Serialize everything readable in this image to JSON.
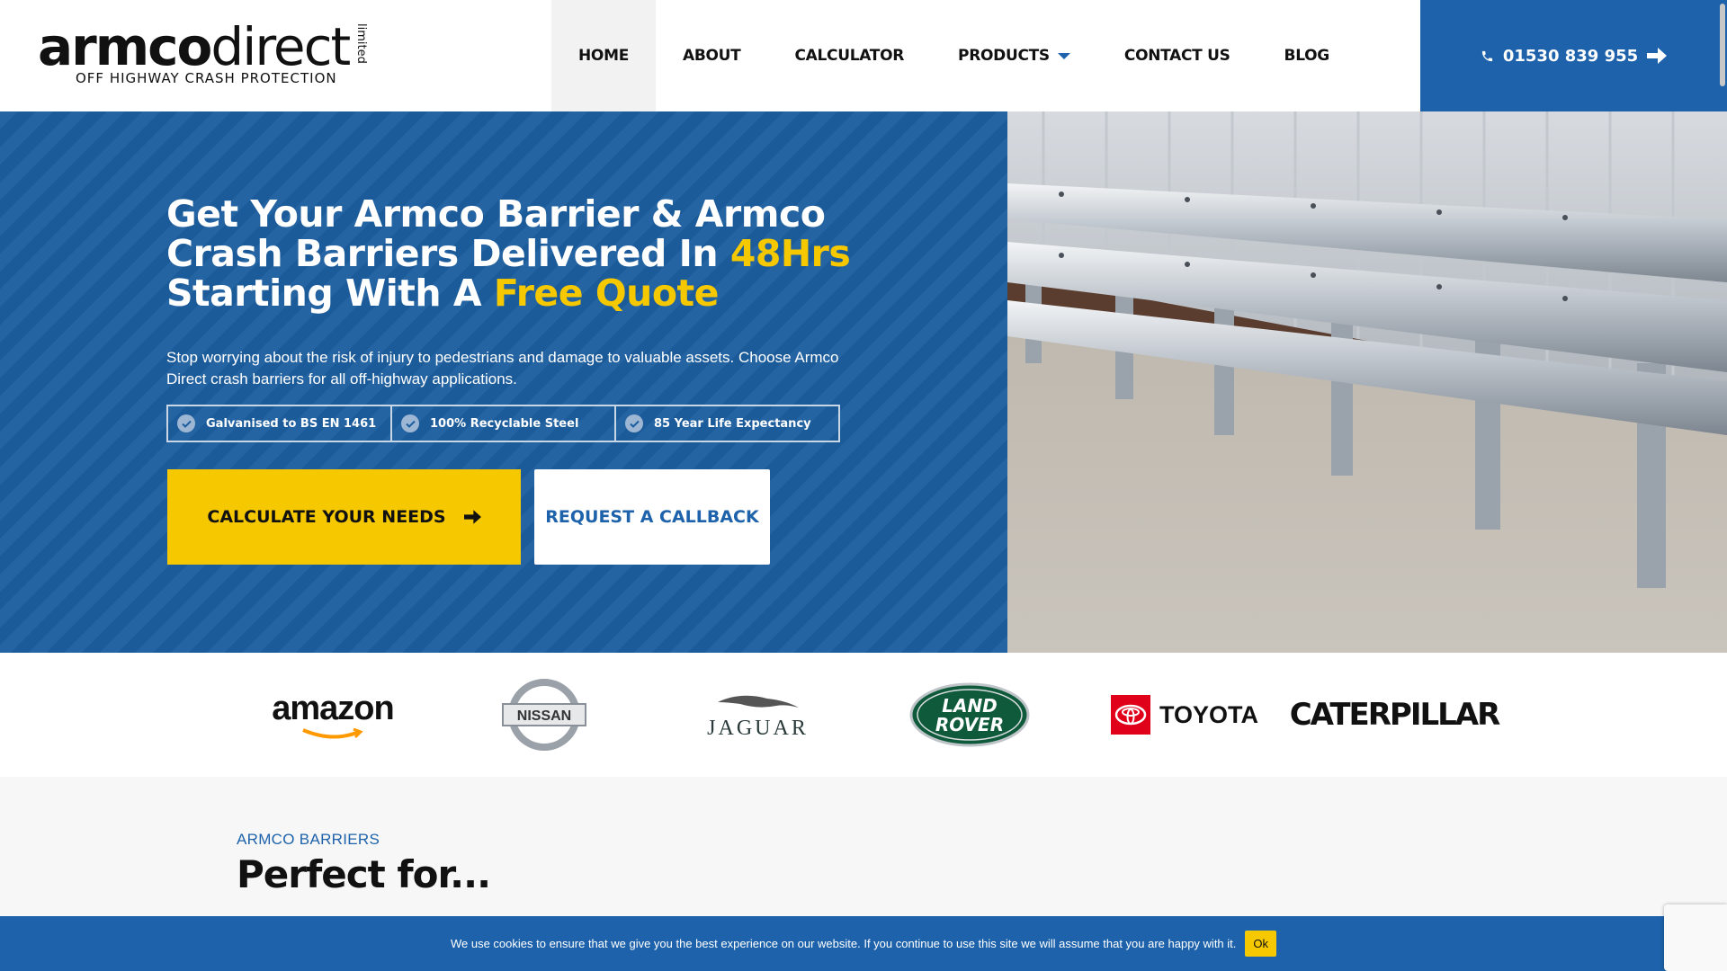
{
  "header": {
    "logo": {
      "bold": "armco",
      "light": "direct",
      "limited": "limited",
      "tagline": "OFF HIGHWAY CRASH PROTECTION"
    },
    "nav": [
      {
        "label": "HOME",
        "active": true
      },
      {
        "label": "ABOUT"
      },
      {
        "label": "CALCULATOR"
      },
      {
        "label": "PRODUCTS",
        "has_dropdown": true
      },
      {
        "label": "CONTACT US"
      },
      {
        "label": "BLOG"
      }
    ],
    "phone": "01530 839 955"
  },
  "hero": {
    "title_1": "Get Your Armco Barrier & Armco Crash Barriers Delivered In ",
    "title_hl1": "48Hrs",
    "title_2": " Starting With A ",
    "title_hl2": "Free Quote",
    "description": "Stop worrying about the risk of injury to pedestrians and damage to valuable assets. Choose Armco Direct crash barriers for all off-highway applications.",
    "features": [
      "Galvanised to BS EN 1461",
      "100% Recyclable Steel",
      "85 Year Life Expectancy"
    ],
    "cta_primary": "CALCULATE YOUR NEEDS",
    "cta_secondary": "REQUEST A CALLBACK"
  },
  "brands": {
    "amazon": "amazon",
    "nissan": "NISSAN",
    "jaguar": "JAGUAR",
    "landrover_1": "LAND",
    "landrover_2": "ROVER",
    "toyota": "TOYOTA",
    "caterpillar": "CATERPILLAR"
  },
  "section": {
    "eyebrow": "ARMCO BARRIERS",
    "title": "Perfect for..."
  },
  "cookie": {
    "message": "We use cookies to ensure that we give you the best experience on our website. If you continue to use this site we will assume that you are happy with it.",
    "ok": "Ok",
    "close": "×"
  },
  "colors": {
    "brand_blue": "#1d62aa",
    "accent_yellow": "#f6c800"
  }
}
